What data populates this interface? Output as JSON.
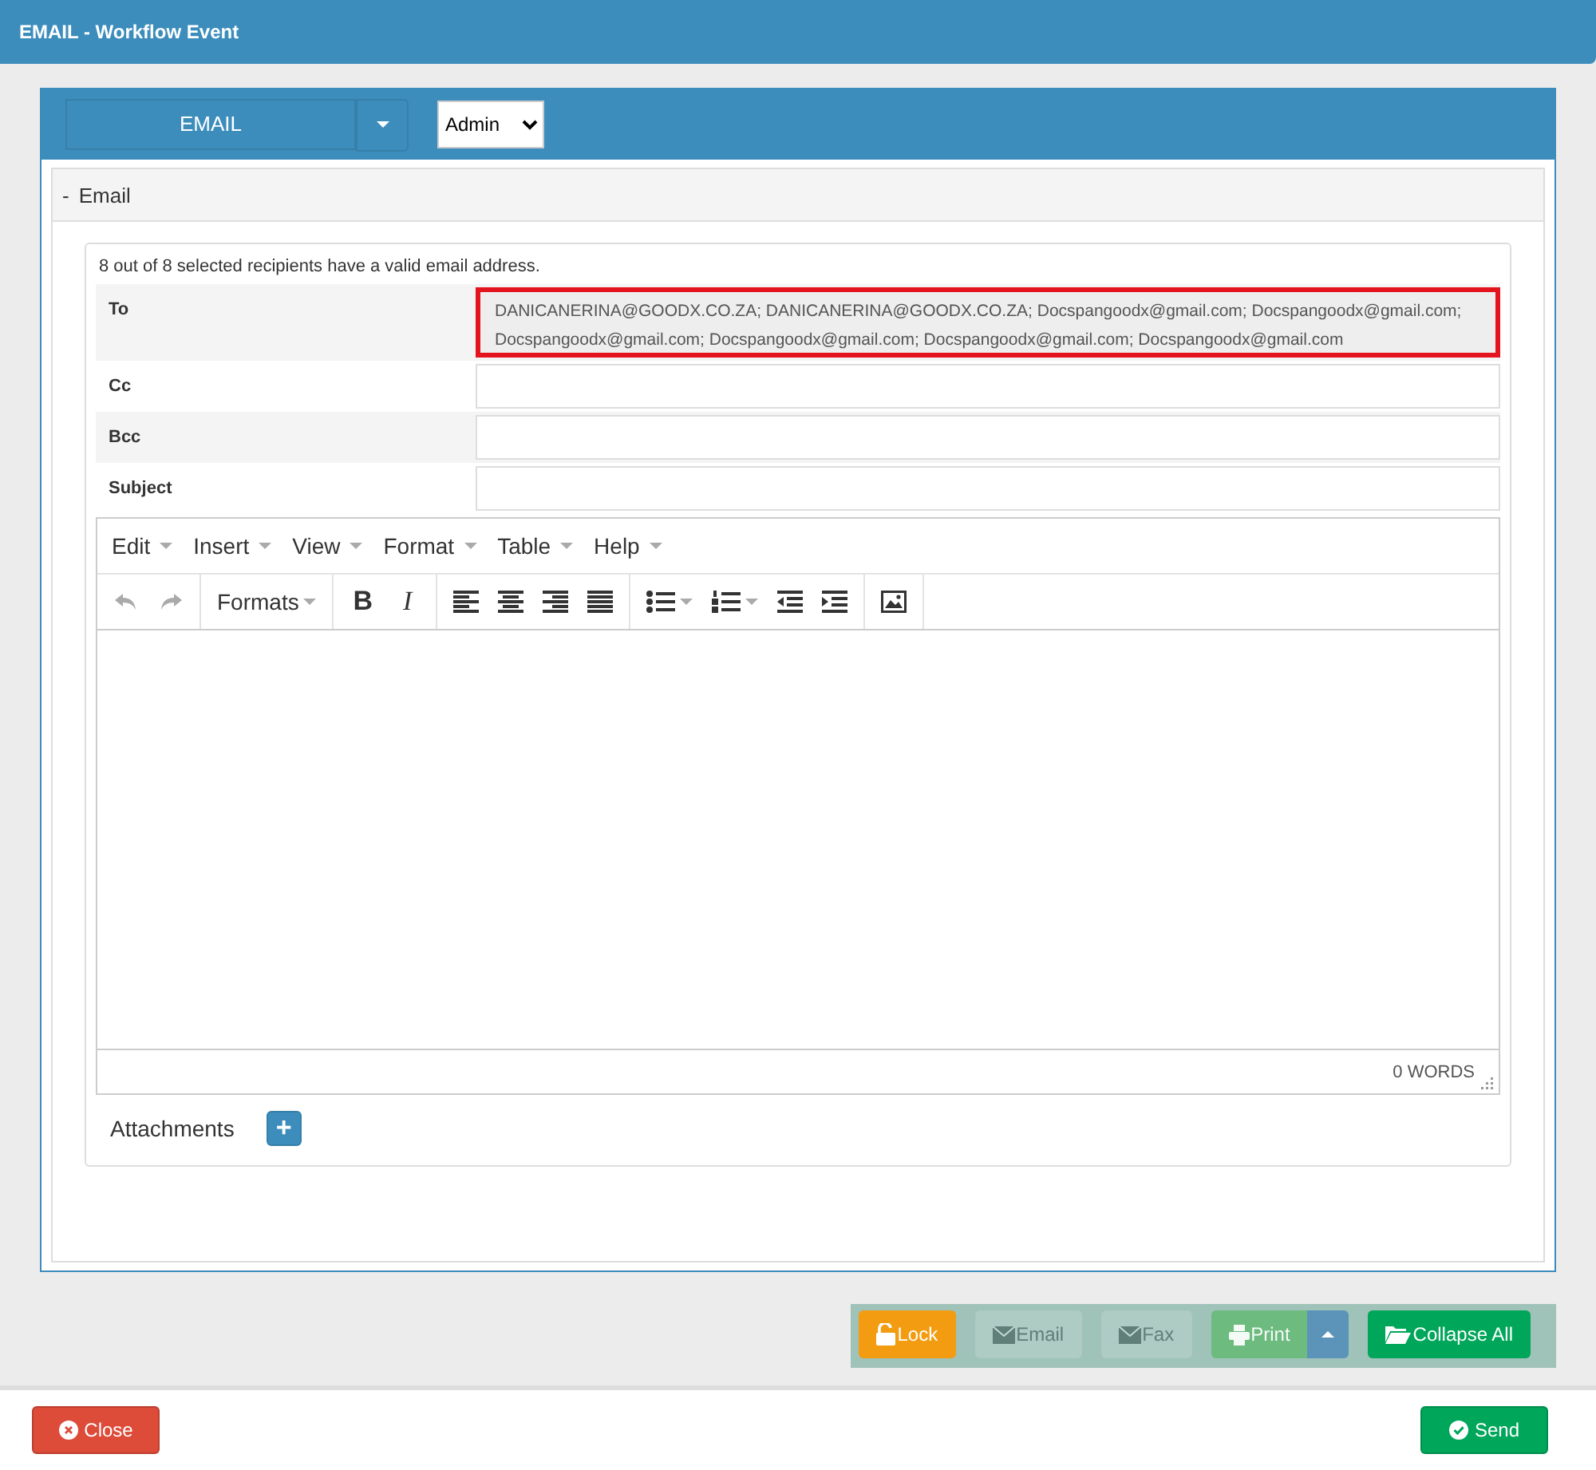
{
  "window": {
    "title": "EMAIL - Workflow Event"
  },
  "panel": {
    "type_button": "EMAIL",
    "user_select": "Admin"
  },
  "section": {
    "toggle": "-",
    "title": "Email"
  },
  "form": {
    "notice": "8 out of 8 selected recipients have a valid email address.",
    "fields": [
      {
        "label": "To",
        "value": "DANICANERINA@GOODX.CO.ZA; DANICANERINA@GOODX.CO.ZA; Docspangoodx@gmail.com; Docspangoodx@gmail.com; Docspangoodx@gmail.com; Docspangoodx@gmail.com; Docspangoodx@gmail.com; Docspangoodx@gmail.com",
        "highlighted": true,
        "kind": "textarea"
      },
      {
        "label": "Cc",
        "highlighted": false,
        "kind": "input"
      },
      {
        "label": "Bcc",
        "highlighted": false,
        "kind": "input"
      },
      {
        "label": "Subject",
        "highlighted": false,
        "kind": "input"
      }
    ]
  },
  "editor": {
    "menu": [
      "Edit",
      "Insert",
      "View",
      "Format",
      "Table",
      "Help"
    ],
    "toolbar": [
      [
        {
          "kind": "undo",
          "disabled": true
        },
        {
          "kind": "redo",
          "disabled": true
        }
      ],
      [
        {
          "kind": "dropdown",
          "label": "Formats",
          "disabled": false
        }
      ],
      [
        {
          "kind": "bold",
          "label": "B",
          "disabled": false
        },
        {
          "kind": "italic",
          "label": "I",
          "disabled": false
        }
      ],
      [
        {
          "kind": "align-left",
          "disabled": false
        },
        {
          "kind": "align-center",
          "disabled": false
        },
        {
          "kind": "align-right",
          "disabled": false
        },
        {
          "kind": "justify",
          "disabled": false
        }
      ],
      [
        {
          "kind": "bullet-list",
          "disabled": false,
          "split": true
        },
        {
          "kind": "numbered-list",
          "disabled": false,
          "split": true
        },
        {
          "kind": "outdent",
          "disabled": false
        },
        {
          "kind": "indent",
          "disabled": false
        }
      ],
      [
        {
          "kind": "image",
          "disabled": false
        }
      ]
    ],
    "word_count": "0 WORDS"
  },
  "attachments": {
    "label": "Attachments",
    "add": "+"
  },
  "actions": [
    {
      "label": "Lock",
      "kind": "lock",
      "color": "#f39c12",
      "disabled": false
    },
    {
      "label": "Email",
      "kind": "email",
      "color": "#aecbc4",
      "disabled": true
    },
    {
      "label": "Fax",
      "kind": "fax",
      "color": "#aecbc4",
      "disabled": true
    },
    {
      "label": "Print",
      "kind": "print",
      "color": "#6dbb7f",
      "disabled": true,
      "split": true
    },
    {
      "label": "Collapse All",
      "kind": "folder",
      "color": "#00a65a",
      "disabled": false
    }
  ],
  "footer": [
    {
      "label": "Close",
      "kind": "close"
    },
    {
      "label": "Send",
      "kind": "send"
    }
  ]
}
